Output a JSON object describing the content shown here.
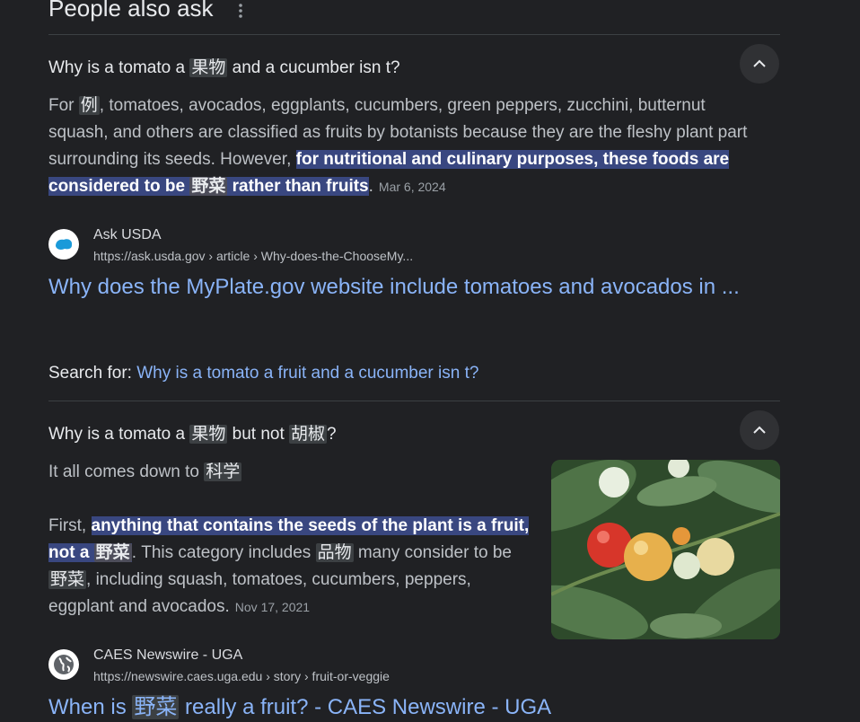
{
  "section": {
    "title": "People also ask",
    "menu_icon": "more-vert-icon"
  },
  "q1": {
    "pre": "Why is a tomato a ",
    "box1": "果物",
    "post": " and a cucumber isn t?",
    "answer_a": "For ",
    "answer_box": "例",
    "answer_b": ", tomatoes, avocados, eggplants, cucumbers, green peppers, zucchini, butternut squash, and others are classified as fruits by botanists because they are the fleshy plant part surrounding its seeds. However, ",
    "mark_a": "for nutritional and culinary purposes, these foods are considered to be ",
    "mark_box": "野菜",
    "mark_b": " rather than fruits",
    "answer_end": ".",
    "date": "Mar 6, 2024",
    "site_name": "Ask USDA",
    "site_url": "https://ask.usda.gov › article › Why-does-the-ChooseMy...",
    "link": "Why does the MyPlate.gov website include tomatoes and avocados in ..."
  },
  "search_for": {
    "label": "Search for: ",
    "query": "Why is a tomato a fruit and a cucumber isn t?"
  },
  "q2": {
    "pre": "Why is a tomato a ",
    "box1": "果物",
    "mid": " but not ",
    "box2": "胡椒",
    "post": "?",
    "line1_a": "It all comes down to ",
    "line1_box": "科学",
    "p2_a": "First, ",
    "mark_a": "anything that contains the seeds of the plant is a fruit, not a ",
    "mark_box": "野菜",
    "p2_b": ". This category includes ",
    "p2_box1": "品物",
    "p2_c": " many consider to be ",
    "p2_box2": "野菜",
    "p2_d": ", including squash, tomatoes, cucumbers, peppers, eggplant and avocados.",
    "date": "Nov 17, 2021",
    "site_name": "CAES Newswire - UGA",
    "site_url": "https://newswire.caes.uga.edu › story › fruit-or-veggie",
    "link_a": "When is ",
    "link_box": "野菜",
    "link_b": " really a fruit? - CAES Newswire - UGA"
  },
  "colors": {
    "background": "#202124",
    "link": "#8ab4f8",
    "highlight": "#394780"
  }
}
